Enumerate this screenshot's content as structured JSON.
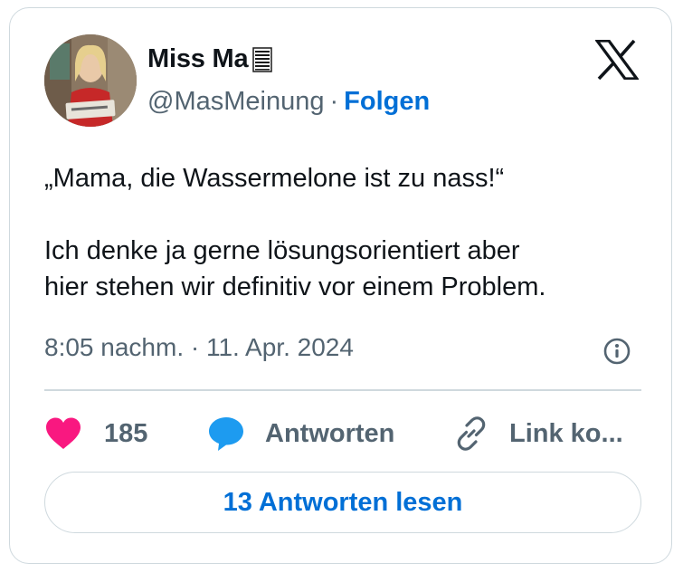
{
  "author": {
    "display_name": "Miss Ma",
    "name_emoji": "memo-emoji",
    "handle": "@MasMeinung",
    "separator": "·",
    "follow_label": "Folgen"
  },
  "platform_logo": "x-logo",
  "tweet": {
    "line_1": "„Mama, die Wassermelone ist zu nass!“",
    "line_2": "Ich denke ja gerne lösungsorientiert aber",
    "line_3": "hier stehen wir definitiv vor einem Problem.",
    "timestamp": "8:05 nachm. · 11. Apr. 2024"
  },
  "actions": {
    "like_count": "185",
    "reply_label": "Antworten",
    "copy_link_label": "Link ko..."
  },
  "read_replies_label": "13 Antworten lesen",
  "icons": {
    "like": "heart-icon",
    "reply": "speech-bubble-icon",
    "copy": "link-icon",
    "info": "info-icon"
  },
  "colors": {
    "link_blue": "#006fd6",
    "heart_pink": "#f91880",
    "reply_blue": "#1d9bf0",
    "muted_text": "#536471",
    "border": "#cfd9de"
  }
}
